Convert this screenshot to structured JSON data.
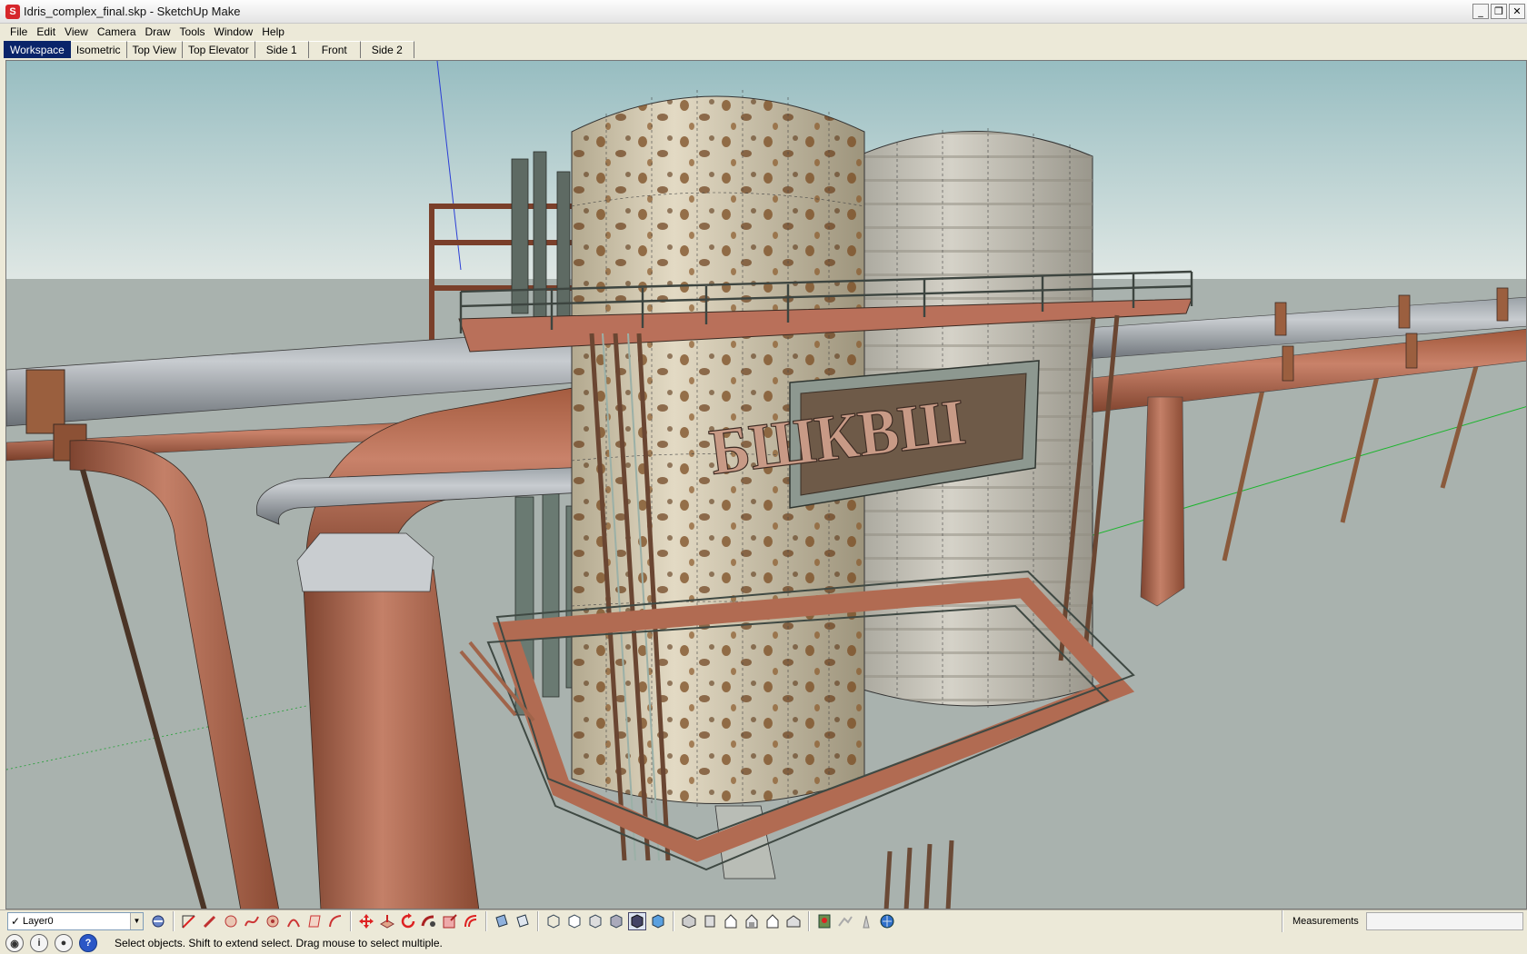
{
  "window": {
    "title": "Idris_complex_final.skp - SketchUp Make",
    "controls": {
      "minimize": "_",
      "restore": "❐",
      "close": "✕"
    }
  },
  "menu": [
    "File",
    "Edit",
    "View",
    "Camera",
    "Draw",
    "Tools",
    "Window",
    "Help"
  ],
  "tabs": [
    "Workspace",
    "Isometric",
    "Top View",
    "Top Elevator",
    "Side 1",
    "Front",
    "Side 2"
  ],
  "active_tab": "Workspace",
  "viewport": {
    "sign_text": "БШКВШ"
  },
  "layer": {
    "name": "Layer0"
  },
  "toolbar_groups": [
    [
      "select-icon",
      "pencil-icon",
      "circle-icon",
      "freehand-icon",
      "polygon-icon",
      "arc-icon",
      "rectangle-icon",
      "line-icon"
    ],
    [
      "move-icon",
      "pushpull-icon",
      "rotate-icon",
      "followme-icon",
      "scale-icon",
      "offset-icon"
    ],
    [
      "section-plane-icon",
      "section-display-icon"
    ],
    [
      "xray-icon",
      "wireframe-icon",
      "hiddenline-icon",
      "shaded-icon",
      "textured-icon",
      "monochrome-icon"
    ],
    [
      "iso-view-icon",
      "top-view-icon",
      "front-view-icon",
      "right-view-icon",
      "back-view-icon",
      "left-view-icon"
    ],
    [
      "add-location-icon",
      "terrain-icon",
      "photo-texture-icon",
      "geolocation-icon"
    ]
  ],
  "measurements": {
    "label": "Measurements",
    "value": ""
  },
  "status": {
    "message": "Select objects. Shift to extend select. Drag mouse to select multiple.",
    "icons": [
      "geo-location-icon",
      "credits-icon",
      "user-icon",
      "help-icon"
    ]
  },
  "colors": {
    "sky_top": "#9cc0c4",
    "ground": "#a8b2ad",
    "rust": "#b5694a",
    "tank_light": "#d8d0bb",
    "active_tab": "#0a246a"
  }
}
